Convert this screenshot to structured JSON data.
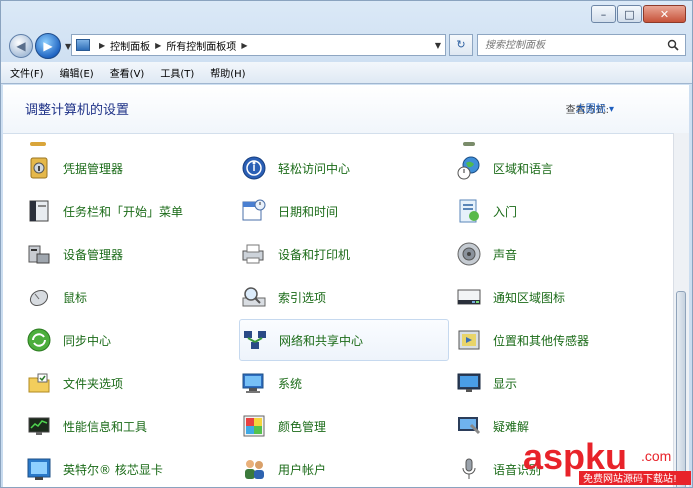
{
  "address": {
    "crumbs": [
      "控制面板",
      "所有控制面板项"
    ]
  },
  "search": {
    "placeholder": "搜索控制面板"
  },
  "menu": [
    "文件(F)",
    "编辑(E)",
    "查看(V)",
    "工具(T)",
    "帮助(H)"
  ],
  "header": {
    "title": "调整计算机的设置",
    "view_label": "查看方式:",
    "view_value": "大图标"
  },
  "items": {
    "credential": "凭据管理器",
    "ease": "轻松访问中心",
    "region": "区域和语言",
    "taskbar": "任务栏和「开始」菜单",
    "datetime": "日期和时间",
    "getstarted": "入门",
    "devmgr": "设备管理器",
    "devprint": "设备和打印机",
    "sound": "声音",
    "mouse": "鼠标",
    "indexing": "索引选项",
    "notify": "通知区域图标",
    "sync": "同步中心",
    "network": "网络和共享中心",
    "location": "位置和其他传感器",
    "folder": "文件夹选项",
    "system": "系统",
    "display": "显示",
    "perf": "性能信息和工具",
    "color": "颜色管理",
    "trouble": "疑难解",
    "intel": "英特尔® 核芯显卡",
    "users": "用户帐户",
    "speech": "语音识别"
  },
  "watermark": {
    "brand": "aspku",
    "domain": ".com",
    "tagline": "免费网站源码下载站!"
  },
  "colors": {
    "link_green": "#1b6b18",
    "title_blue": "#1e3287",
    "accent_red": "#e8232a"
  }
}
